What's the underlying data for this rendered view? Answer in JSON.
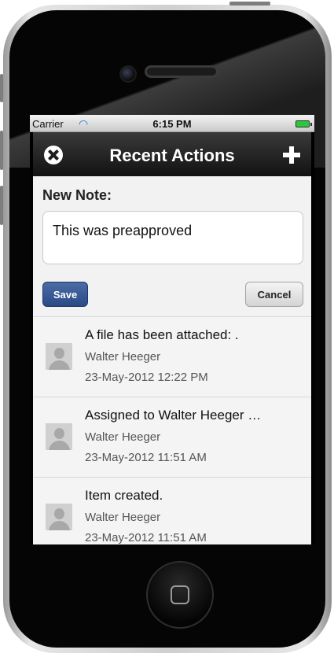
{
  "status_bar": {
    "carrier": "Carrier",
    "time": "6:15 PM"
  },
  "header": {
    "title": "Recent Actions"
  },
  "note": {
    "label": "New Note:",
    "value": "This was preapproved"
  },
  "buttons": {
    "save": "Save",
    "cancel": "Cancel"
  },
  "actions": [
    {
      "title": "A file has been attached: .",
      "user": "Walter Heeger",
      "date": "23-May-2012 12:22 PM"
    },
    {
      "title": "Assigned to Walter Heeger …",
      "user": "Walter Heeger",
      "date": "23-May-2012 11:51 AM"
    },
    {
      "title": "Item created.",
      "user": "Walter Heeger",
      "date": "23-May-2012 11:51 AM"
    }
  ],
  "icons": {
    "close": "close-icon",
    "add": "plus-icon",
    "wifi": "wifi-icon",
    "battery": "battery-icon",
    "avatar": "user-avatar-icon"
  },
  "colors": {
    "save_button": "#2a4a86",
    "header": "#1d1d1d",
    "battery": "#29c93b"
  }
}
